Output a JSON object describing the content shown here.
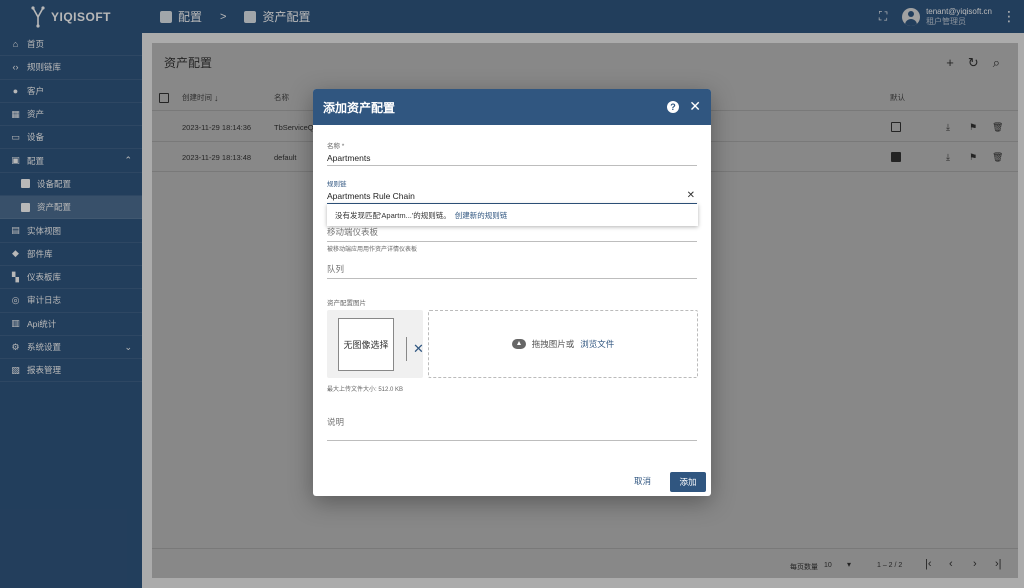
{
  "app": {
    "brand": "YIQISOFT"
  },
  "breadcrumb": {
    "parent": "配置",
    "separator": ">",
    "current": "资产配置"
  },
  "user": {
    "email": "tenant@yiqisoft.cn",
    "role": "租户管理员"
  },
  "sidebar": {
    "items": [
      {
        "label": "首页",
        "icon": "home-icon"
      },
      {
        "label": "规则链库",
        "icon": "code-icon"
      },
      {
        "label": "客户",
        "icon": "people-icon"
      },
      {
        "label": "资产",
        "icon": "domain-icon"
      },
      {
        "label": "设备",
        "icon": "devices-icon"
      },
      {
        "label": "配置",
        "icon": "settings-box-icon",
        "expanded": true
      },
      {
        "label": "设备配置",
        "icon": "device-profile-icon",
        "sub": true
      },
      {
        "label": "资产配置",
        "icon": "asset-profile-icon",
        "sub": true,
        "active": true
      },
      {
        "label": "实体视图",
        "icon": "view-quilt-icon"
      },
      {
        "label": "部件库",
        "icon": "widgets-icon"
      },
      {
        "label": "仪表板库",
        "icon": "dashboard-icon"
      },
      {
        "label": "审计日志",
        "icon": "track-changes-icon"
      },
      {
        "label": "Api统计",
        "icon": "insert-chart-icon"
      },
      {
        "label": "系统设置",
        "icon": "gear-icon",
        "collapsible": true
      },
      {
        "label": "报表管理",
        "icon": "pdf-icon"
      }
    ]
  },
  "main": {
    "title": "资产配置",
    "columns": {
      "created": "创建时间",
      "name": "名称",
      "default": "默认"
    },
    "rows": [
      {
        "created": "2023-11-29 18:14:36",
        "name": "TbServiceQ",
        "is_default": false
      },
      {
        "created": "2023-11-29 18:13:48",
        "name": "default",
        "is_default": true
      }
    ],
    "footer": {
      "page_size_label": "每页数量",
      "page_size": "10",
      "range": "1 – 2 / 2"
    }
  },
  "dialog": {
    "title": "添加资产配置",
    "name_label": "名称 *",
    "name_value": "Apartments",
    "rule_chain_label": "规则链",
    "rule_chain_value": "Apartments Rule Chain",
    "suggest_text": "没有发现匹配'Apartm...'的规则链。",
    "suggest_link": "创建新的规则链",
    "mobile_dashboard_placeholder": "移动端仪表板",
    "mobile_dashboard_hint": "被移动端应用用作资产详情仪表板",
    "queue_placeholder": "队列",
    "image_label": "资产配置图片",
    "no_image": "无图像选择",
    "drop_text": "拖拽图片或",
    "browse_link": "浏览文件",
    "max_size": "最大上传文件大小: 512.0 KB",
    "description_placeholder": "说明",
    "cancel_label": "取消",
    "add_label": "添加"
  },
  "colors": {
    "primary": "#305680",
    "overlay": "rgba(0,0,0,0.28)"
  }
}
